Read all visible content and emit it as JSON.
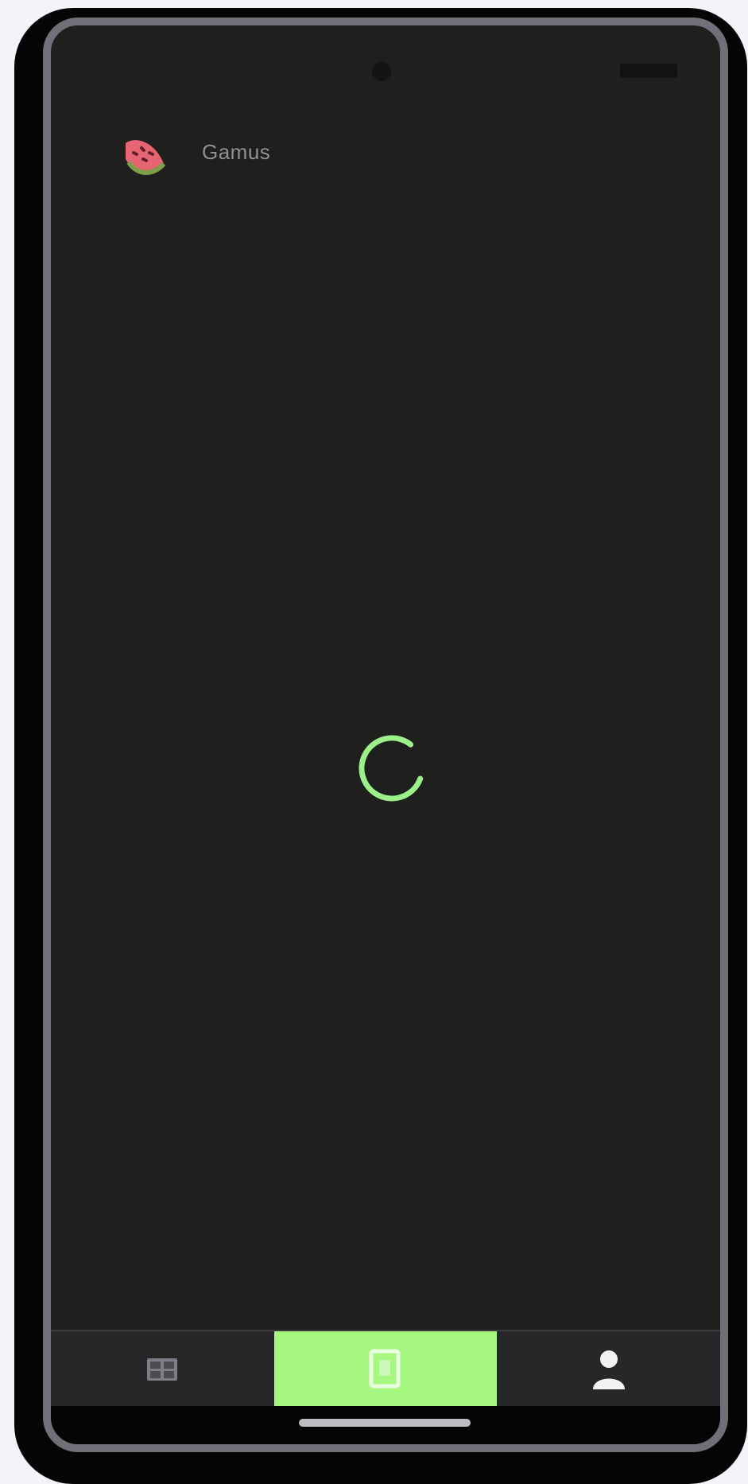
{
  "app": {
    "name": "Gamus",
    "logo_icon": "watermelon-icon"
  },
  "status_bar": {
    "icons": [
      "camera-cutout",
      "signal-battery-icons"
    ]
  },
  "content": {
    "state": "loading",
    "spinner_icon": "loading-spinner-icon",
    "spinner_progress": 0.8
  },
  "bottom_nav": {
    "items": [
      {
        "icon": "grid-icon",
        "active": false
      },
      {
        "icon": "card-icon",
        "active": true
      },
      {
        "icon": "profile-icon",
        "active": false
      }
    ]
  },
  "colors": {
    "background": "#1f1f1d",
    "accent": "#a6f77f",
    "spinner": "#9bf08a",
    "logo": "#e76573"
  }
}
